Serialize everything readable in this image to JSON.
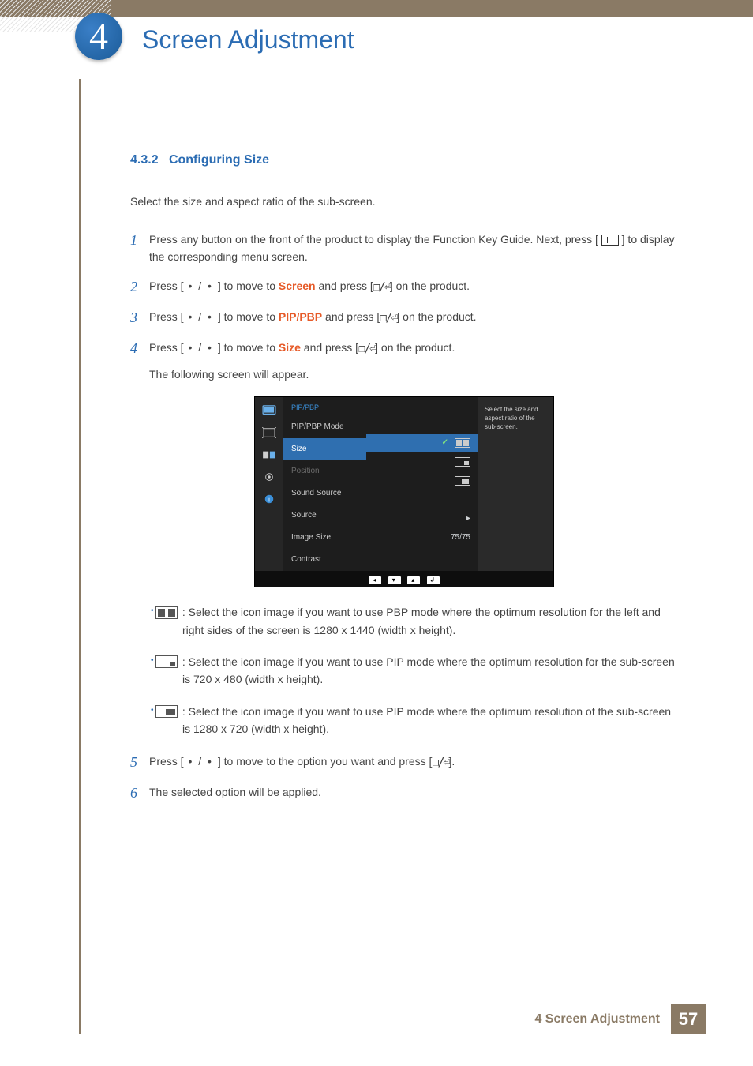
{
  "chapter": {
    "number": "4",
    "title": "Screen Adjustment"
  },
  "section": {
    "number": "4.3.2",
    "title": "Configuring Size"
  },
  "intro": "Select the size and aspect ratio of the sub-screen.",
  "steps": {
    "s1": {
      "num": "1",
      "a": "Press any button on the front of the product to display the Function Key Guide. Next, press [",
      "b": "] to display the corresponding menu screen."
    },
    "s2": {
      "num": "2",
      "pre": "Press [",
      "dots": " • / • ",
      "mid": "] to move to ",
      "kw": "Screen",
      "post1": " and press [",
      "post2": "] on the product."
    },
    "s3": {
      "num": "3",
      "pre": "Press [",
      "dots": " • / • ",
      "mid": "] to move to ",
      "kw": "PIP/PBP",
      "post1": " and press [",
      "post2": "] on the product."
    },
    "s4": {
      "num": "4",
      "pre": "Press [",
      "dots": " • / • ",
      "mid": "] to move to ",
      "kw": "Size",
      "post1": " and press [",
      "post2": "] on the product.",
      "note": "The following screen will appear."
    },
    "s5": {
      "num": "5",
      "pre": "Press [",
      "dots": " • / • ",
      "mid": "] to move to the option you want and press [",
      "post": "]."
    },
    "s6": {
      "num": "6",
      "text": "The selected option will be applied."
    }
  },
  "osd": {
    "crumb": "PIP/PBP",
    "items": {
      "mode": "PIP/PBP Mode",
      "size": "Size",
      "position": "Position",
      "sound": "Sound Source",
      "source": "Source",
      "image": "Image Size",
      "contrast": "Contrast"
    },
    "contrast_value": "75/75",
    "arrow": "▸",
    "helper": "Select the size and aspect ratio of the sub-screen."
  },
  "bullets": {
    "b1": ": Select the icon image if you want to use PBP mode where the optimum resolution for the left and right sides of the screen is 1280 x 1440 (width x height).",
    "b2": ": Select the icon image if you want to use PIP mode where the optimum resolution for the sub-screen is 720 x 480 (width x height).",
    "b3": ": Select the icon image if you want to use PIP mode where the optimum resolution of the sub-screen is 1280 x 720 (width x height)."
  },
  "footer": {
    "label": "4 Screen Adjustment",
    "page": "57"
  }
}
